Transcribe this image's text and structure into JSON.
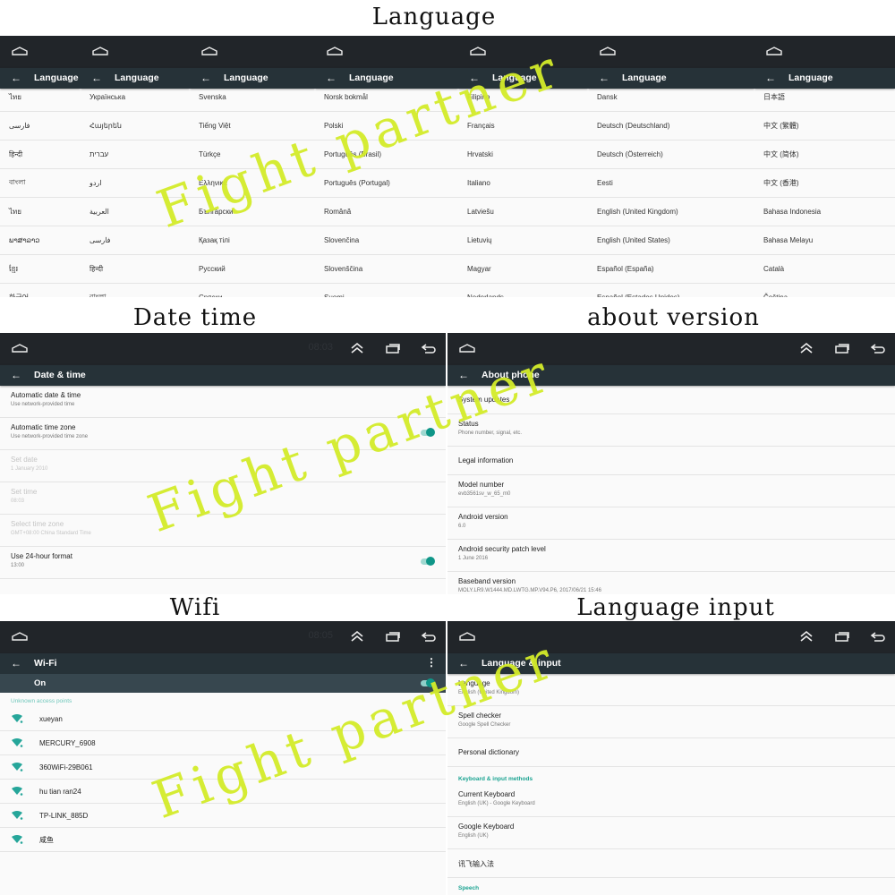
{
  "captions": {
    "language": "Language",
    "date_time": "Date time",
    "about_version": "about version",
    "wifi": "Wifi",
    "language_input": "Language input"
  },
  "watermark": "Fight partner",
  "colors": {
    "system_bar": "#212529",
    "app_bar": "#263238",
    "accent": "#0f9688",
    "watermark": "#d4ec2a"
  },
  "language_panels": [
    {
      "title": "Language",
      "items": [
        "ไทย",
        "فارسی",
        "हिन्दी",
        "বাংলা",
        "ไทย",
        "ພາສາລາວ",
        "ខ្មែរ",
        "한국어"
      ]
    },
    {
      "title": "Language",
      "items": [
        "Українська",
        "Հայերեն",
        "עברית",
        "اردو",
        "العربية",
        "فارسی",
        "हिन्दी",
        "বাংলা"
      ]
    },
    {
      "title": "Language",
      "items": [
        "Svenska",
        "Tiếng Việt",
        "Türkçe",
        "Ελληνικά",
        "Български",
        "Қазақ тілі",
        "Русский",
        "Српски"
      ]
    },
    {
      "title": "Language",
      "items": [
        "Norsk bokmål",
        "Polski",
        "Português (Brasil)",
        "Português (Portugal)",
        "Română",
        "Slovenčina",
        "Slovenščina",
        "Suomi"
      ]
    },
    {
      "title": "Language",
      "items": [
        "Filipino",
        "Français",
        "Hrvatski",
        "Italiano",
        "Latviešu",
        "Lietuvių",
        "Magyar",
        "Nederlands"
      ]
    },
    {
      "title": "Language",
      "items": [
        "Dansk",
        "Deutsch (Deutschland)",
        "Deutsch (Österreich)",
        "Eesti",
        "English (United Kingdom)",
        "English (United States)",
        "Español (España)",
        "Español (Estados Unidos)"
      ]
    },
    {
      "title": "Language",
      "items": [
        "日本語",
        "中文 (繁體)",
        "中文 (简体)",
        "中文 (香港)",
        "Bahasa Indonesia",
        "Bahasa Melayu",
        "Català",
        "Čeština"
      ]
    }
  ],
  "date_time": {
    "clock": "08:03",
    "title": "Date & time",
    "items": [
      {
        "title": "Automatic date & time",
        "subtitle": "Use network-provided time",
        "disabled": false,
        "toggle": null
      },
      {
        "title": "Automatic time zone",
        "subtitle": "Use network-provided time zone",
        "disabled": false,
        "toggle": true
      },
      {
        "title": "Set date",
        "subtitle": "1 January 2010",
        "disabled": true,
        "toggle": null
      },
      {
        "title": "Set time",
        "subtitle": "08:03",
        "disabled": true,
        "toggle": null
      },
      {
        "title": "Select time zone",
        "subtitle": "GMT+08:00 China Standard Time",
        "disabled": true,
        "toggle": null
      },
      {
        "title": "Use 24-hour format",
        "subtitle": "13:00",
        "disabled": false,
        "toggle": true
      }
    ]
  },
  "about_phone": {
    "title": "About phone",
    "items": [
      {
        "title": "System updates",
        "subtitle": ""
      },
      {
        "title": "Status",
        "subtitle": "Phone number, signal, etc."
      },
      {
        "title": "Legal information",
        "subtitle": ""
      },
      {
        "title": "Model number",
        "subtitle": "evb3561sv_w_65_m0"
      },
      {
        "title": "Android version",
        "subtitle": "6.0"
      },
      {
        "title": "Android security patch level",
        "subtitle": "1 June 2016"
      },
      {
        "title": "Baseband version",
        "subtitle": "MOLY.LR9.W1444.MD.LWTG.MP.V94.P6, 2017/06/21 15:46"
      }
    ]
  },
  "wifi": {
    "clock": "08:05",
    "title": "Wi-Fi",
    "status": "On",
    "section": "Unknown access points",
    "networks": [
      "xueyan",
      "MERCURY_6908",
      "360WiFi-29B061",
      "hu tian ran24",
      "TP-LINK_885D",
      "咸鱼"
    ]
  },
  "language_input": {
    "title": "Language & input",
    "items": [
      {
        "title": "Language",
        "subtitle": "English (United Kingdom)"
      },
      {
        "title": "Spell checker",
        "subtitle": "Google Spell Checker"
      },
      {
        "title": "Personal dictionary",
        "subtitle": ""
      }
    ],
    "section_keyboard": "Keyboard & input methods",
    "keyboard_items": [
      {
        "title": "Current Keyboard",
        "subtitle": "English (UK) - Google Keyboard"
      },
      {
        "title": "Google Keyboard",
        "subtitle": "English (UK)"
      },
      {
        "title": "讯飞输入法",
        "subtitle": ""
      }
    ],
    "section_speech": "Speech"
  }
}
